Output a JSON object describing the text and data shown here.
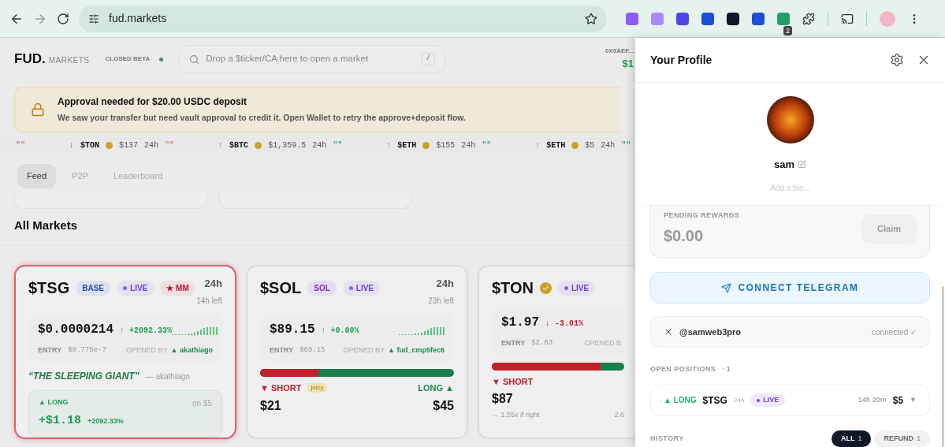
{
  "browser": {
    "url": "fud.markets",
    "extension_badge": "2"
  },
  "header": {
    "logo": "FUD.",
    "logo_suffix": "MARKETS",
    "beta": "CLOSED BETA",
    "search_placeholder": "Drop a $ticker/CA here to open a market",
    "search_key": "/",
    "wallet": "0X9AEF...",
    "balance": "$1"
  },
  "banner": {
    "title": "Approval needed for $20.00 USDC deposit",
    "text": "We saw your transfer but need vault approval to credit it. Open Wallet to retry the approve+deposit flow."
  },
  "ticker": {
    "lead_note": "\"\"",
    "items": [
      {
        "kind": "down",
        "arrow": "↓",
        "symbol": "$TON",
        "price": "$137",
        "period": "24h",
        "note": "\"\""
      },
      {
        "kind": "up",
        "arrow": "↑",
        "symbol": "$BTC",
        "price": "$1,359.5",
        "period": "24h",
        "note": "\"\""
      },
      {
        "kind": "up",
        "arrow": "↑",
        "symbol": "$ETH",
        "price": "$155",
        "period": "24h",
        "note": "\"\""
      },
      {
        "kind": "up",
        "arrow": "↑",
        "symbol": "$ETH",
        "price": "$5",
        "period": "24h",
        "note": "\"\""
      }
    ]
  },
  "tabs": [
    {
      "label": "Feed",
      "selected": true
    },
    {
      "label": "P2P",
      "selected": false
    },
    {
      "label": "Leaderboard",
      "selected": false
    }
  ],
  "section_title": "All Markets",
  "markets": [
    {
      "symbol": "$TSG",
      "verified": false,
      "highlighted": true,
      "badges": [
        {
          "kind": "chain",
          "label": "BASE"
        },
        {
          "kind": "status",
          "label": "LIVE"
        },
        {
          "kind": "flag",
          "label": "★ MM"
        }
      ],
      "period": "24h",
      "time_left": "14h left",
      "price": "$0.0000214",
      "kind": "up",
      "change": "↑ +2092.33%",
      "entry_label": "ENTRY",
      "entry": "$9.775e-7",
      "opened_label": "OPENED BY",
      "opener": "▲ akathiago",
      "quote": "“THE SLEEPING GIANT”",
      "quote_author": "— akathiago",
      "position": {
        "label": "▲ LONG",
        "stake": "on $5",
        "pnl": "+$1.18",
        "pnl_pct": "+2092.33%"
      }
    },
    {
      "symbol": "$SOL",
      "verified": false,
      "highlighted": false,
      "badges": [
        {
          "kind": "token",
          "label": "SOL"
        },
        {
          "kind": "status",
          "label": "LIVE"
        }
      ],
      "period": "24h",
      "time_left": "23h left",
      "price": "$89.15",
      "kind": "up",
      "change": "↑ +0.00%",
      "entry_label": "ENTRY",
      "entry": "$89.15",
      "opened_label": "OPENED BY",
      "opener": "▲ fud_cmp5fec6",
      "pool": {
        "level": 0.3,
        "short_label": "▼ SHORT",
        "tag": "juicy",
        "long_label": "LONG ▲",
        "short_amount": "$21",
        "long_amount": "$45"
      }
    },
    {
      "symbol": "$TON",
      "verified": true,
      "highlighted": false,
      "badges": [
        {
          "kind": "status",
          "label": "LIVE"
        }
      ],
      "price": "$1.97",
      "kind": "down",
      "change": "↓ -3.01%",
      "entry_label": "ENTRY",
      "entry": "$2.03",
      "opened_label": "OPENED B",
      "pool": {
        "level": 0.82,
        "short_label": "▼ SHORT",
        "short_amount": "$87",
        "short_note": "→ 1.55x if right",
        "long_note": "2.6"
      }
    }
  ],
  "profile": {
    "title": "Your Profile",
    "name": "sam",
    "bio_placeholder": "Add a bio...",
    "rewards_label": "PENDING REWARDS",
    "rewards": "$0.00",
    "claim": {
      "label": "Claim",
      "disabled": true
    },
    "telegram": "CONNECT TELEGRAM",
    "x_handle": "@samweb3pro",
    "x_status": "connected ✓",
    "positions_label": "OPEN POSITIONS",
    "positions_count": "· 1",
    "positions": [
      {
        "label": "▲ LONG",
        "symbol": "$TSG",
        "period": "24h",
        "status": "LIVE",
        "time": "14h 20m",
        "stake": "$5",
        "toggle": "▼"
      }
    ],
    "history_label": "HISTORY",
    "filters": [
      {
        "label": "ALL",
        "count": "1",
        "selected": true
      },
      {
        "label": "REFUND",
        "count": "1",
        "selected": false
      }
    ]
  }
}
